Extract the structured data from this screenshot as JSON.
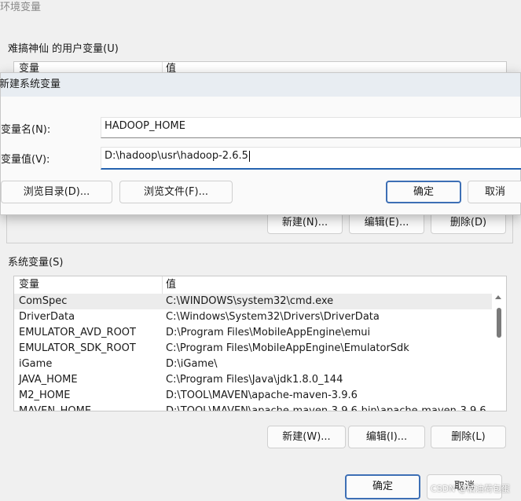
{
  "window": {
    "title": "环境变量"
  },
  "user_vars": {
    "group_label": "难搞神仙 的用户变量(U)",
    "col_name": "变量",
    "col_value": "值",
    "buttons": {
      "new": "新建(N)...",
      "edit": "编辑(E)...",
      "delete": "删除(D)"
    }
  },
  "system_vars": {
    "group_label": "系统变量(S)",
    "col_name": "变量",
    "col_value": "值",
    "rows": [
      {
        "name": "ComSpec",
        "value": "C:\\WINDOWS\\system32\\cmd.exe"
      },
      {
        "name": "DriverData",
        "value": "C:\\Windows\\System32\\Drivers\\DriverData"
      },
      {
        "name": "EMULATOR_AVD_ROOT",
        "value": "D:\\Program Files\\MobileAppEngine\\emui"
      },
      {
        "name": "EMULATOR_SDK_ROOT",
        "value": "C:\\Program Files\\MobileAppEngine\\EmulatorSdk"
      },
      {
        "name": "iGame",
        "value": "D:\\iGame\\"
      },
      {
        "name": "JAVA_HOME",
        "value": "C:\\Program Files\\Java\\jdk1.8.0_144"
      },
      {
        "name": "M2_HOME",
        "value": "D:\\TOOL\\MAVEN\\apache-maven-3.9.6"
      },
      {
        "name": "MAVEN_HOME",
        "value": "D:\\TOOL\\MAVEN\\apache-maven-3.9.6-bin\\apache-maven-3.9.6"
      }
    ],
    "buttons": {
      "new": "新建(W)...",
      "edit": "编辑(I)...",
      "delete": "删除(L)"
    }
  },
  "footer": {
    "ok": "确定",
    "cancel": "取消"
  },
  "dialog": {
    "title": "新建系统变量",
    "name_label": "变量名(N):",
    "name_value": "HADOOP_HOME",
    "value_label": "变量值(V):",
    "value_value": "D:\\hadoop\\usr\\hadoop-2.6.5",
    "browse_dir": "浏览目录(D)...",
    "browse_file": "浏览文件(F)...",
    "ok": "确定",
    "cancel": "取消"
  },
  "watermark": "CSDN @橘油荷包蛋"
}
